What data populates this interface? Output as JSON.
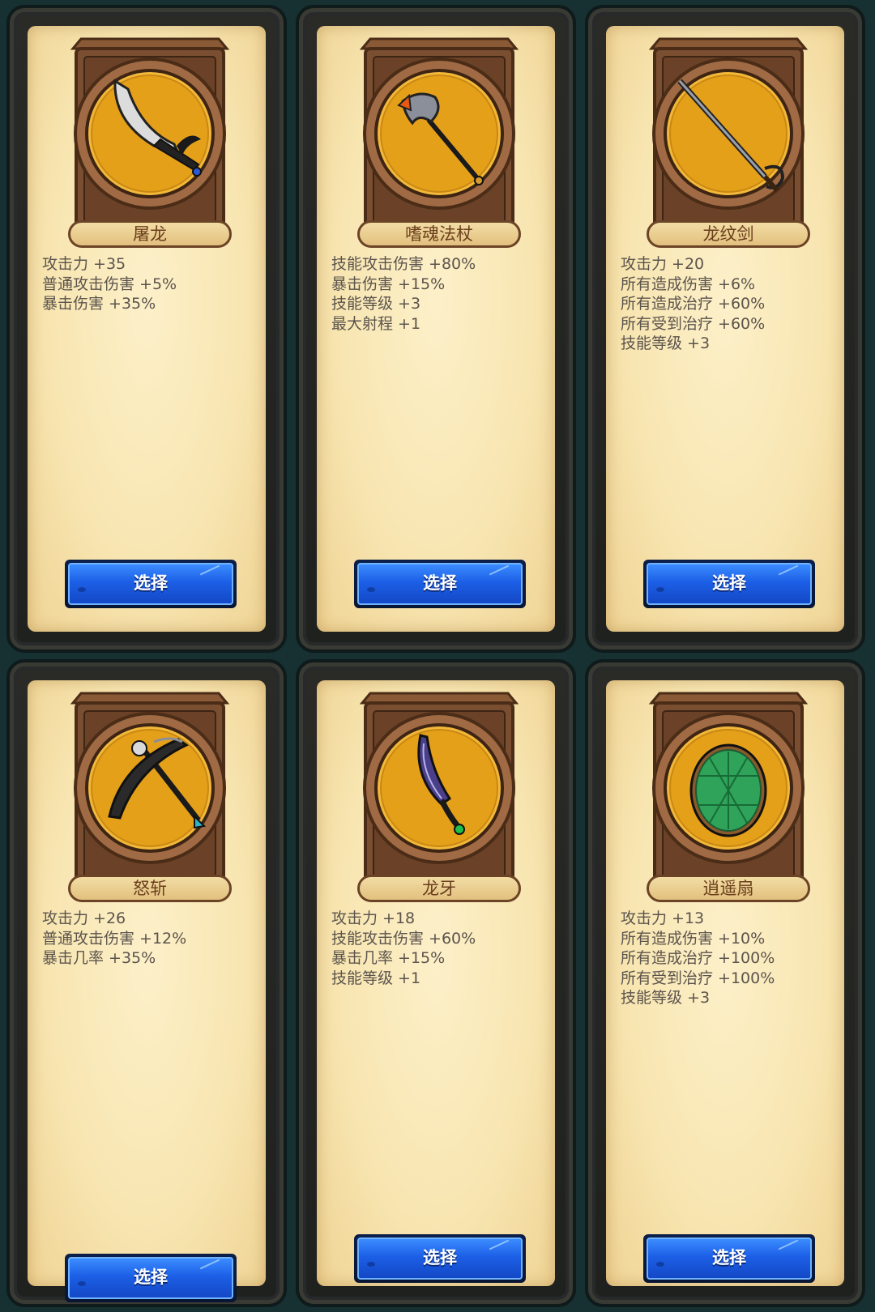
{
  "cards": [
    {
      "name": "屠龙",
      "icon": "scythe-blade-icon",
      "stats": [
        "攻击力 +35",
        "普通攻击伤害 +5%",
        "暴击伤害 +35%"
      ],
      "button": "选择"
    },
    {
      "name": "嗜魂法杖",
      "icon": "soul-staff-icon",
      "stats": [
        "技能攻击伤害 +80%",
        "暴击伤害 +15%",
        "技能等级 +3",
        "最大射程 +1"
      ],
      "button": "选择"
    },
    {
      "name": "龙纹剑",
      "icon": "rapier-sword-icon",
      "stats": [
        "攻击力 +20",
        "所有造成伤害 +6%",
        "所有造成治疗 +60%",
        "所有受到治疗 +60%",
        "技能等级 +3"
      ],
      "button": "选择"
    },
    {
      "name": "怒斩",
      "icon": "pickaxe-icon",
      "stats": [
        "攻击力 +26",
        "普通攻击伤害 +12%",
        "暴击几率 +35%"
      ],
      "button": "选择"
    },
    {
      "name": "龙牙",
      "icon": "dragon-fang-dagger-icon",
      "stats": [
        "攻击力 +18",
        "技能攻击伤害 +60%",
        "暴击几率 +15%",
        "技能等级 +1"
      ],
      "button": "选择"
    },
    {
      "name": "逍遥扇",
      "icon": "turtle-shell-fan-icon",
      "stats": [
        "攻击力 +13",
        "所有造成伤害 +10%",
        "所有造成治疗 +100%",
        "所有受到治疗 +100%",
        "技能等级 +3"
      ],
      "button": "选择"
    }
  ],
  "colors": {
    "background": "#173032",
    "paper": "#f8e6b2",
    "frame": "#7a4e30",
    "medallion": "#e9a516",
    "button": "#1c5fe6",
    "stat_text": "#5b544d"
  }
}
